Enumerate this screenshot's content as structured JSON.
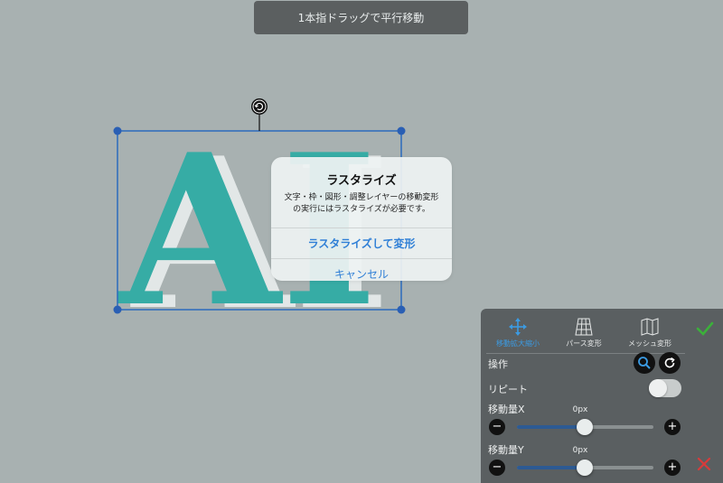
{
  "hint": {
    "text": "1本指ドラッグで平行移動"
  },
  "artwork": {
    "letters": "AI",
    "colors": {
      "fill": "#36aca5",
      "shadow": "#e2e7e7",
      "selection": "#2a6bbd"
    }
  },
  "dialog": {
    "title": "ラスタライズ",
    "message_line1": "文字・枠・図形・調整レイヤーの移動変形",
    "message_line2": "の実行にはラスタライズが必要です。",
    "primary_button": "ラスタライズして変形",
    "cancel_button": "キャンセル"
  },
  "panel": {
    "tabs": [
      {
        "label": "移動拡大縮小",
        "icon": "move-arrows-icon",
        "active": true
      },
      {
        "label": "パース変形",
        "icon": "perspective-grid-icon",
        "active": false
      },
      {
        "label": "メッシュ変形",
        "icon": "mesh-map-icon",
        "active": false
      }
    ],
    "operation_label": "操作",
    "repeat_label": "リピート",
    "repeat_on": false,
    "move_x": {
      "label": "移動量X",
      "value": "0px",
      "level": 0.5
    },
    "move_y": {
      "label": "移動量Y",
      "value": "0px",
      "level": 0.5
    },
    "colors": {
      "active": "#3b9be3",
      "confirm": "#3bb03a",
      "cancel": "#d83b3b"
    }
  }
}
